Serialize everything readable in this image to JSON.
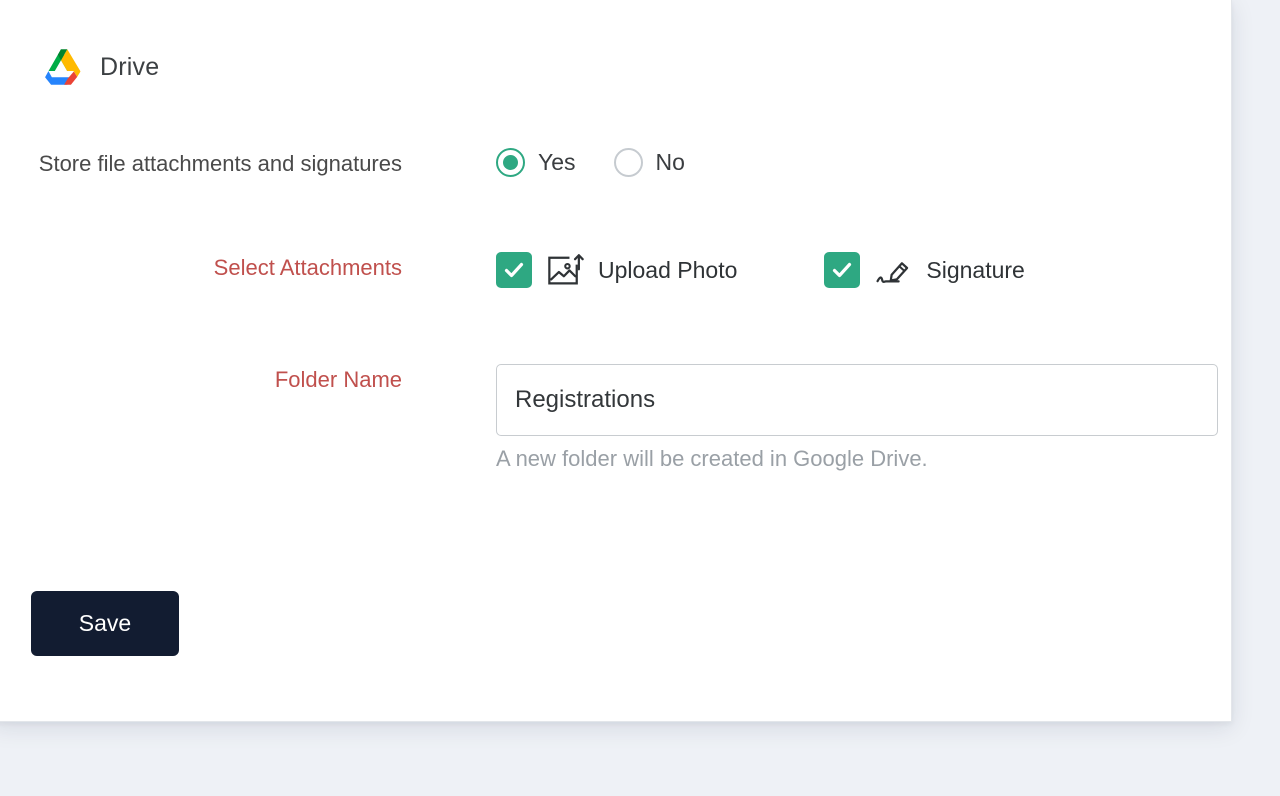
{
  "app": {
    "brand_name": "Drive",
    "logo_icon": "google-drive-logo"
  },
  "form": {
    "store_attachments": {
      "label": "Store file attachments and signatures",
      "options": [
        {
          "label": "Yes",
          "selected": true
        },
        {
          "label": "No",
          "selected": false
        }
      ]
    },
    "select_attachments": {
      "label": "Select Attachments",
      "options": [
        {
          "label": "Upload Photo",
          "checked": true,
          "icon": "image-upload-icon"
        },
        {
          "label": "Signature",
          "checked": true,
          "icon": "signature-pen-icon"
        }
      ]
    },
    "folder_name": {
      "label": "Folder Name",
      "value": "Registrations",
      "placeholder": "Folder name",
      "helper_text": "A new folder will be created in Google Drive."
    }
  },
  "actions": {
    "save_label": "Save"
  },
  "colors": {
    "accent_teal": "#2ea882",
    "label_red": "#c0504d",
    "save_navy": "#121c31",
    "helper_gray": "#9aa0a6",
    "drive_green": "#00ac47",
    "drive_yellow": "#ffba00",
    "drive_blue": "#2684fc",
    "drive_red": "#ea4335"
  }
}
